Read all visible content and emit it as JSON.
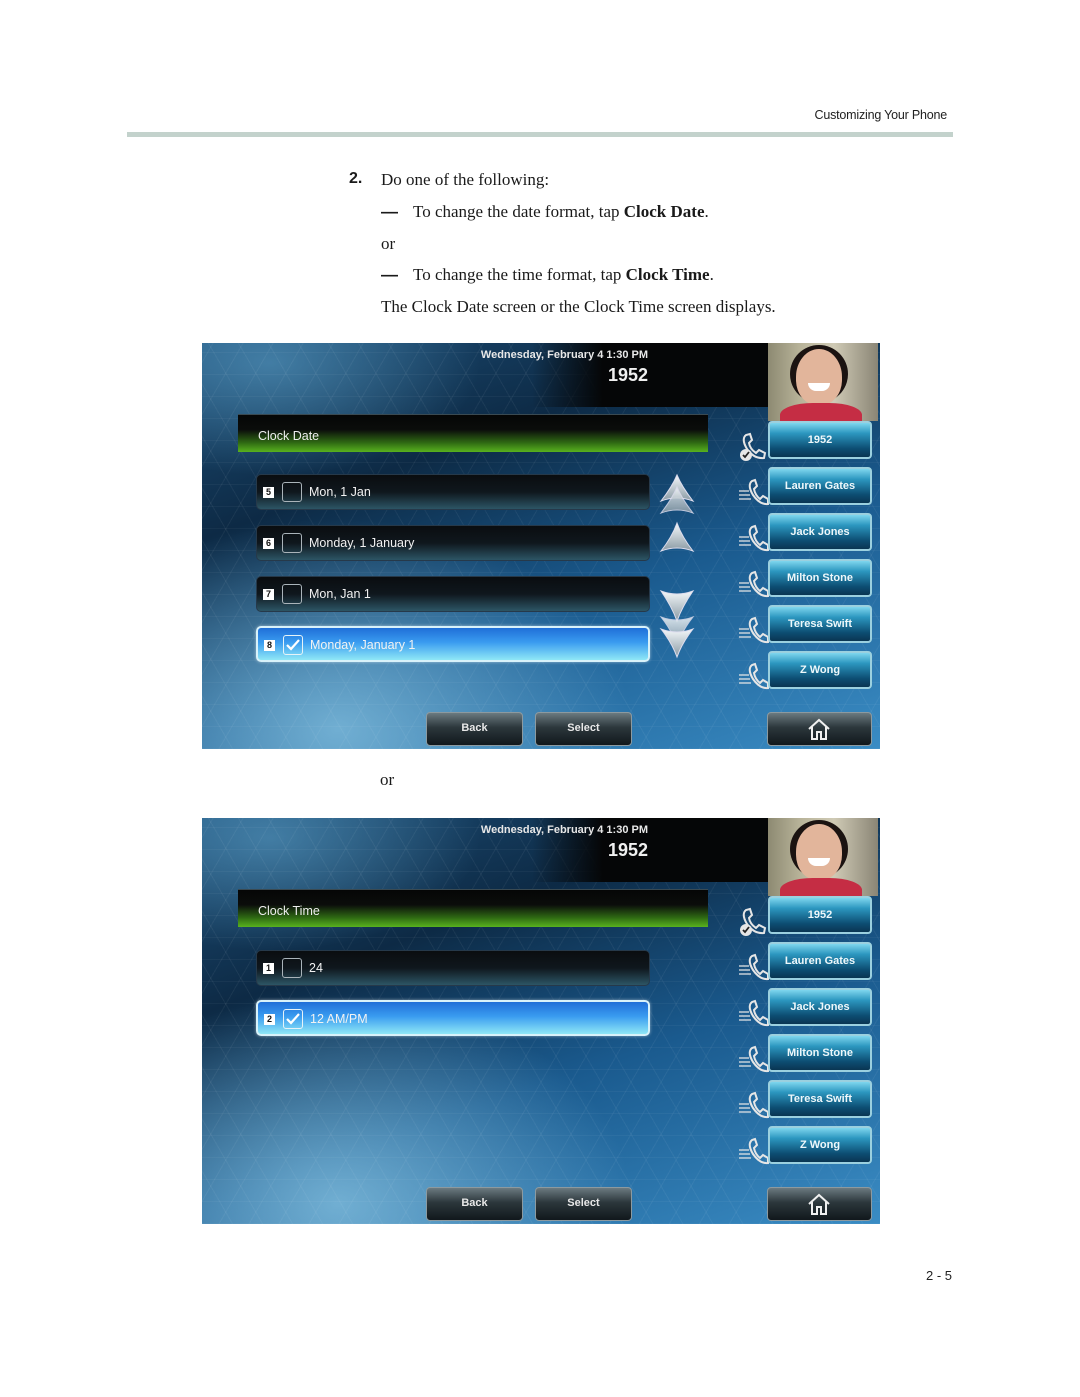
{
  "header": {
    "running_head": "Customizing Your Phone"
  },
  "instructions": {
    "step_number": "2.",
    "step_text": "Do one of the following:",
    "bullets": [
      {
        "dash": "—",
        "prefix": "To change the date format, tap ",
        "bold": "Clock Date",
        "suffix": "."
      },
      {
        "dash": "—",
        "prefix": "To change the time format, tap ",
        "bold": "Clock Time",
        "suffix": "."
      }
    ],
    "or_label": "or",
    "result_text": "The Clock Date screen or the Clock Time screen displays."
  },
  "between_screens_or": "or",
  "screens": [
    {
      "datetime": "Wednesday, February 4  1:30 PM",
      "extension": "1952",
      "title": "Clock Date",
      "options": [
        {
          "num": "5",
          "label": "Mon, 1 Jan",
          "checked": false
        },
        {
          "num": "6",
          "label": "Monday, 1 January",
          "checked": false
        },
        {
          "num": "7",
          "label": "Mon, Jan 1",
          "checked": false
        },
        {
          "num": "8",
          "label": "Monday, January 1",
          "checked": true
        }
      ],
      "scroll_icons": [
        "page-up-icon",
        "scroll-up-icon",
        "scroll-down-icon",
        "page-down-icon"
      ],
      "lines": [
        {
          "label": "1952",
          "icon": "registered-line-icon"
        },
        {
          "label": "Lauren Gates",
          "icon": "speed-dial-icon"
        },
        {
          "label": "Jack Jones",
          "icon": "speed-dial-icon"
        },
        {
          "label": "Milton Stone",
          "icon": "speed-dial-icon"
        },
        {
          "label": "Teresa Swift",
          "icon": "speed-dial-icon"
        },
        {
          "label": "Z Wong",
          "icon": "speed-dial-icon"
        }
      ],
      "softkeys": {
        "back": "Back",
        "select": "Select",
        "home_icon": "home-icon"
      }
    },
    {
      "datetime": "Wednesday, February 4  1:30 PM",
      "extension": "1952",
      "title": "Clock Time",
      "options": [
        {
          "num": "1",
          "label": "24",
          "checked": false
        },
        {
          "num": "2",
          "label": "12 AM/PM",
          "checked": true
        }
      ],
      "lines": [
        {
          "label": "1952",
          "icon": "registered-line-icon"
        },
        {
          "label": "Lauren Gates",
          "icon": "speed-dial-icon"
        },
        {
          "label": "Jack Jones",
          "icon": "speed-dial-icon"
        },
        {
          "label": "Milton Stone",
          "icon": "speed-dial-icon"
        },
        {
          "label": "Teresa Swift",
          "icon": "speed-dial-icon"
        },
        {
          "label": "Z Wong",
          "icon": "speed-dial-icon"
        }
      ],
      "softkeys": {
        "back": "Back",
        "select": "Select",
        "home_icon": "home-icon"
      }
    }
  ],
  "footer": {
    "page_number": "2 - 5"
  },
  "colors": {
    "title_bar_green": "#58b21e",
    "selected_row_blue": "#3a9cf0",
    "header_rule": "#c3d2cc"
  }
}
